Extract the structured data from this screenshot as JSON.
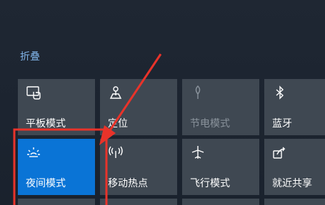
{
  "action_center": {
    "collapse_label": "折叠",
    "tiles": [
      {
        "label": "平板模式",
        "icon": "tablet-mode-icon",
        "state": "normal"
      },
      {
        "label": "定位",
        "icon": "location-icon",
        "state": "normal"
      },
      {
        "label": "节电模式",
        "icon": "battery-saver-icon",
        "state": "disabled"
      },
      {
        "label": "蓝牙",
        "icon": "bluetooth-icon",
        "state": "normal"
      },
      {
        "label": "夜间模式",
        "icon": "night-light-icon",
        "state": "active"
      },
      {
        "label": "移动热点",
        "icon": "mobile-hotspot-icon",
        "state": "normal"
      },
      {
        "label": "飞行模式",
        "icon": "airplane-mode-icon",
        "state": "normal"
      },
      {
        "label": "就近共享",
        "icon": "nearby-sharing-icon",
        "state": "normal"
      }
    ]
  },
  "colors": {
    "tile_background": "#3f4852",
    "tile_active": "#0a74d6",
    "link": "#7fb2e6",
    "annotation": "#e8332a"
  }
}
